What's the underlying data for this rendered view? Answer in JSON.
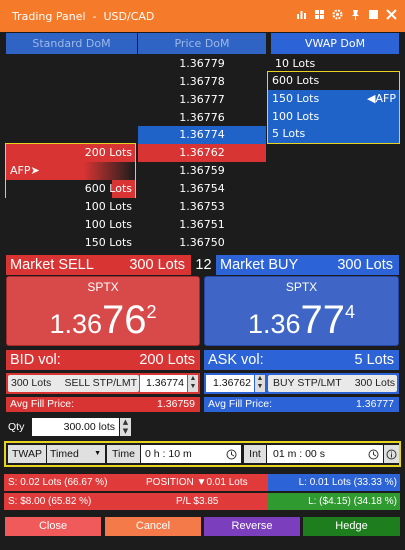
{
  "window": {
    "title": "Trading Panel  -  USD/CAD",
    "icons": [
      "chart-icon",
      "grid-icon",
      "gear-icon",
      "pin-icon",
      "restore-icon",
      "close-icon"
    ]
  },
  "tabs": {
    "standard_dom": "Standard DoM",
    "price_dom": "Price DoM",
    "vwap_dom": "VWAP DoM"
  },
  "ladder": {
    "prices": [
      "1.36779",
      "1.36778",
      "1.36777",
      "1.36776",
      "1.36774",
      "1.36762",
      "1.36759",
      "1.36754",
      "1.36753",
      "1.36751",
      "1.36750"
    ],
    "left_lots": [
      "",
      "",
      "",
      "",
      "",
      "200 Lots",
      "",
      "600 Lots",
      "100 Lots",
      "100 Lots",
      "150 Lots"
    ],
    "right_lots": [
      "10 Lots",
      "600 Lots",
      "150 Lots",
      "100 Lots",
      "5 Lots",
      "",
      "",
      "",
      "",
      "",
      ""
    ],
    "afp_left": "AFP➤",
    "afp_right": "◀AFP"
  },
  "market": {
    "sell_label": "Market SELL",
    "sell_lots": "300 Lots",
    "spread": "12",
    "buy_label": "Market BUY",
    "buy_lots": "300 Lots"
  },
  "quote": {
    "sell_symbol": "SPTX",
    "sell_prefix": "1.36",
    "sell_big": "76",
    "sell_sup": "2",
    "buy_symbol": "SPTX",
    "buy_prefix": "1.36",
    "buy_big": "77",
    "buy_sup": "4"
  },
  "volume": {
    "bid_label": "BID vol:",
    "bid_value": "200 Lots",
    "ask_label": "ASK vol:",
    "ask_value": "5 Lots"
  },
  "stop_limit": {
    "sell_lots": "300 Lots",
    "sell_label": "SELL STP/LMT",
    "sell_price": "1.36774",
    "buy_price": "1.36762",
    "buy_label": "BUY STP/LMT",
    "buy_lots": "300 Lots"
  },
  "fill": {
    "sell_label": "Avg Fill Price:",
    "sell_value": "1.36759",
    "buy_label": "Avg Fill Price:",
    "buy_value": "1.36777"
  },
  "qty": {
    "label": "Qty",
    "value": "300.00 lots"
  },
  "algo": {
    "type": "TWAP",
    "mode": "Timed",
    "time_label": "Time",
    "time_value": "0 h : 10 m",
    "int_label": "Int",
    "int_value": "01 m : 00 s"
  },
  "position": {
    "short_lots": "S: 0.02 Lots (66.67 %)",
    "center": "POSITION ▼0.01 Lots",
    "long_lots": "L: 0.01 Lots (33.33 %)",
    "short_usd": "S: $8.00 (65.82 %)",
    "pl": "P/L $3.85",
    "long_usd": "L: ($4.15) (34.18 %)"
  },
  "actions": {
    "close": "Close",
    "cancel": "Cancel",
    "reverse": "Reverse",
    "hedge": "Hedge"
  },
  "colors": {
    "orange": "#f57a2a",
    "red": "#e83a3a",
    "blue": "#2c63d6",
    "yellow": "#e8d321",
    "purple": "#7b3fbe",
    "green": "#1e7e1e"
  }
}
